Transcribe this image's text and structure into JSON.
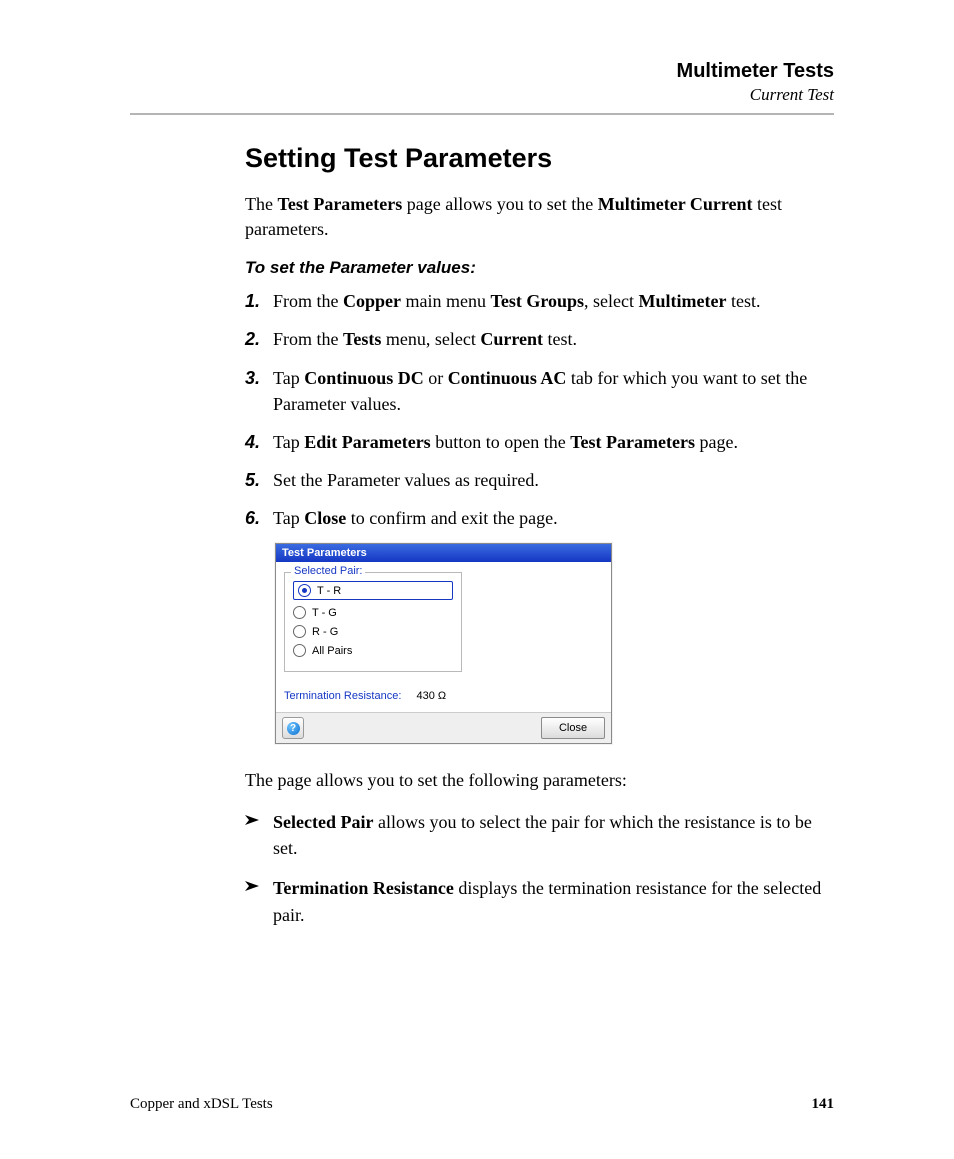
{
  "header": {
    "title": "Multimeter Tests",
    "subtitle": "Current Test"
  },
  "section_title": "Setting Test Parameters",
  "intro": {
    "t1": "The ",
    "b1": "Test Parameters",
    "t2": " page allows you to set the ",
    "b2": "Multimeter Current",
    "t3": " test parameters."
  },
  "steps_heading": "To set the Parameter values:",
  "steps": [
    {
      "num": "1.",
      "pre": "From the ",
      "b1": "Copper",
      "mid1": " main menu ",
      "b2": "Test Groups",
      "mid2": ", select ",
      "b3": "Multimeter",
      "post": " test."
    },
    {
      "num": "2.",
      "pre": "From the ",
      "b1": "Tests",
      "mid1": " menu, select ",
      "b2": "Current",
      "post": " test."
    },
    {
      "num": "3.",
      "pre": "Tap ",
      "b1": "Continuous DC",
      "mid1": " or ",
      "b2": "Continuous AC",
      "post": " tab for which you want to set the Parameter values."
    },
    {
      "num": "4.",
      "pre": "Tap ",
      "b1": "Edit Parameters",
      "mid1": " button to open the ",
      "b2": "Test Parameters",
      "post": " page."
    },
    {
      "num": "5.",
      "plain": "Set the Parameter values as required."
    },
    {
      "num": "6.",
      "pre": "Tap ",
      "b1": "Close",
      "post": " to confirm and exit the page."
    }
  ],
  "dialog": {
    "title": "Test Parameters",
    "fieldset_legend": "Selected Pair:",
    "options": [
      "T - R",
      "T - G",
      "R - G",
      "All Pairs"
    ],
    "selected_index": 0,
    "term_label": "Termination Resistance:",
    "term_value": "430 Ω",
    "help_glyph": "?",
    "close_label": "Close"
  },
  "after_dialog": "The page allows you to set the following parameters:",
  "bullets": [
    {
      "b": "Selected Pair",
      "t": " allows you to select the pair for which the resistance is to be set."
    },
    {
      "b": "Termination Resistance",
      "t": " displays the termination resistance for the selected pair."
    }
  ],
  "footer": {
    "left": "Copper and xDSL Tests",
    "page": "141"
  }
}
